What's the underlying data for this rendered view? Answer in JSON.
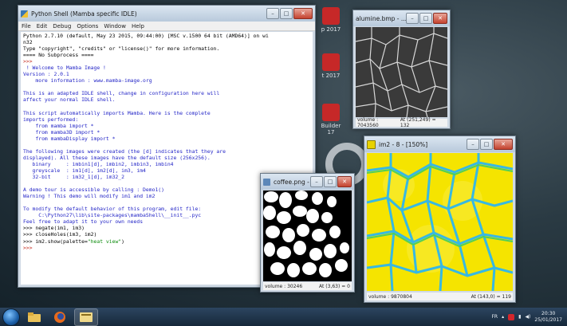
{
  "desktop": {
    "icon_labels": [
      "p 2017",
      "t 2017",
      "Builder",
      "17"
    ]
  },
  "idle": {
    "title": "Python Shell (Mamba specific IDLE)",
    "menu": [
      "File",
      "Edit",
      "Debug",
      "Options",
      "Window",
      "Help"
    ],
    "lines": [
      {
        "t": "Python 2.7.10 (default, May 23 2015, 09:44:00) [MSC v.1500 64 bit (AMD64)] on wi",
        "c": "black"
      },
      {
        "t": "n32",
        "c": "black"
      },
      {
        "t": "Type \"copyright\", \"credits\" or \"license()\" for more information.",
        "c": "black"
      },
      {
        "t": "==== No Subprocess ====",
        "c": "black"
      },
      {
        "t": ">>> ",
        "c": "red"
      },
      {
        "t": " ! Welcome to Mamba Image !",
        "c": "blue"
      },
      {
        "t": "Version : 2.0.1",
        "c": "blue"
      },
      {
        "t": "    more information : www.mamba-image.org",
        "c": "blue"
      },
      {
        "t": "",
        "c": "blue"
      },
      {
        "t": "This is an adapted IDLE shell, change in configuration here will",
        "c": "blue"
      },
      {
        "t": "affect your normal IDLE shell.",
        "c": "blue"
      },
      {
        "t": "",
        "c": "blue"
      },
      {
        "t": "This script automatically imports Mamba. Here is the complete",
        "c": "blue"
      },
      {
        "t": "imports performed:",
        "c": "blue"
      },
      {
        "t": "    from mamba import *",
        "c": "blue"
      },
      {
        "t": "    from mamba3D import *",
        "c": "blue"
      },
      {
        "t": "    from mambaDisplay import *",
        "c": "blue"
      },
      {
        "t": "",
        "c": "blue"
      },
      {
        "t": "The following images were created (the [d] indicates that they are",
        "c": "blue"
      },
      {
        "t": "displayed). All these images have the default size (256x256).",
        "c": "blue"
      },
      {
        "t": "   binary     : imbin1[d], imbin2, imbin3, imbin4",
        "c": "blue"
      },
      {
        "t": "   greyscale  : im1[d], im2[d], im3, im4",
        "c": "blue"
      },
      {
        "t": "   32-bit     : im32_1[d], im32_2",
        "c": "blue"
      },
      {
        "t": "",
        "c": "blue"
      },
      {
        "t": "A demo tour is accessible by calling : Demo1()",
        "c": "blue"
      },
      {
        "t": "Warning ! This demo will modify im1 and im2",
        "c": "blue"
      },
      {
        "t": "",
        "c": "blue"
      },
      {
        "t": "To modify the default behavior of this program, edit file:",
        "c": "blue"
      },
      {
        "t": "     C:\\Python27\\lib\\site-packages\\mambaShell\\__init__.pyc",
        "c": "blue"
      },
      {
        "t": "Feel free to adapt it to your own needs",
        "c": "blue"
      },
      {
        "t": ">>> negate(im1, im3)",
        "c": "black"
      },
      {
        "t": ">>> closeHoles(im3, im2)",
        "c": "black"
      },
      {
        "t": ">>> im2.show(palette=\"heat view\")",
        "c": "black",
        "str": "\"heat view\""
      },
      {
        "t": ">>> ",
        "c": "red"
      }
    ]
  },
  "alumine": {
    "title": "alumine.bmp - ...",
    "status_left": "volume : 7043560",
    "status_right": "At (251,249) = 132"
  },
  "coffee": {
    "title": "coffee.png - 1...",
    "status_left": "volume : 30246",
    "status_right": "At (3,63) = 0"
  },
  "im2": {
    "title": "im2 - 8 - [150%]",
    "status_left": "volume : 9870804",
    "status_right": "At (143,0) = 119"
  },
  "taskbar": {
    "lang": "FR",
    "time": "20:30",
    "date": "25/01/2017"
  },
  "colors": {
    "heat_yellow": "#f5e400",
    "heat_green": "#4fcf5a",
    "heat_cyan": "#37b8e3",
    "prompt_red": "#c42a1e",
    "shell_blue": "#2426c7"
  }
}
